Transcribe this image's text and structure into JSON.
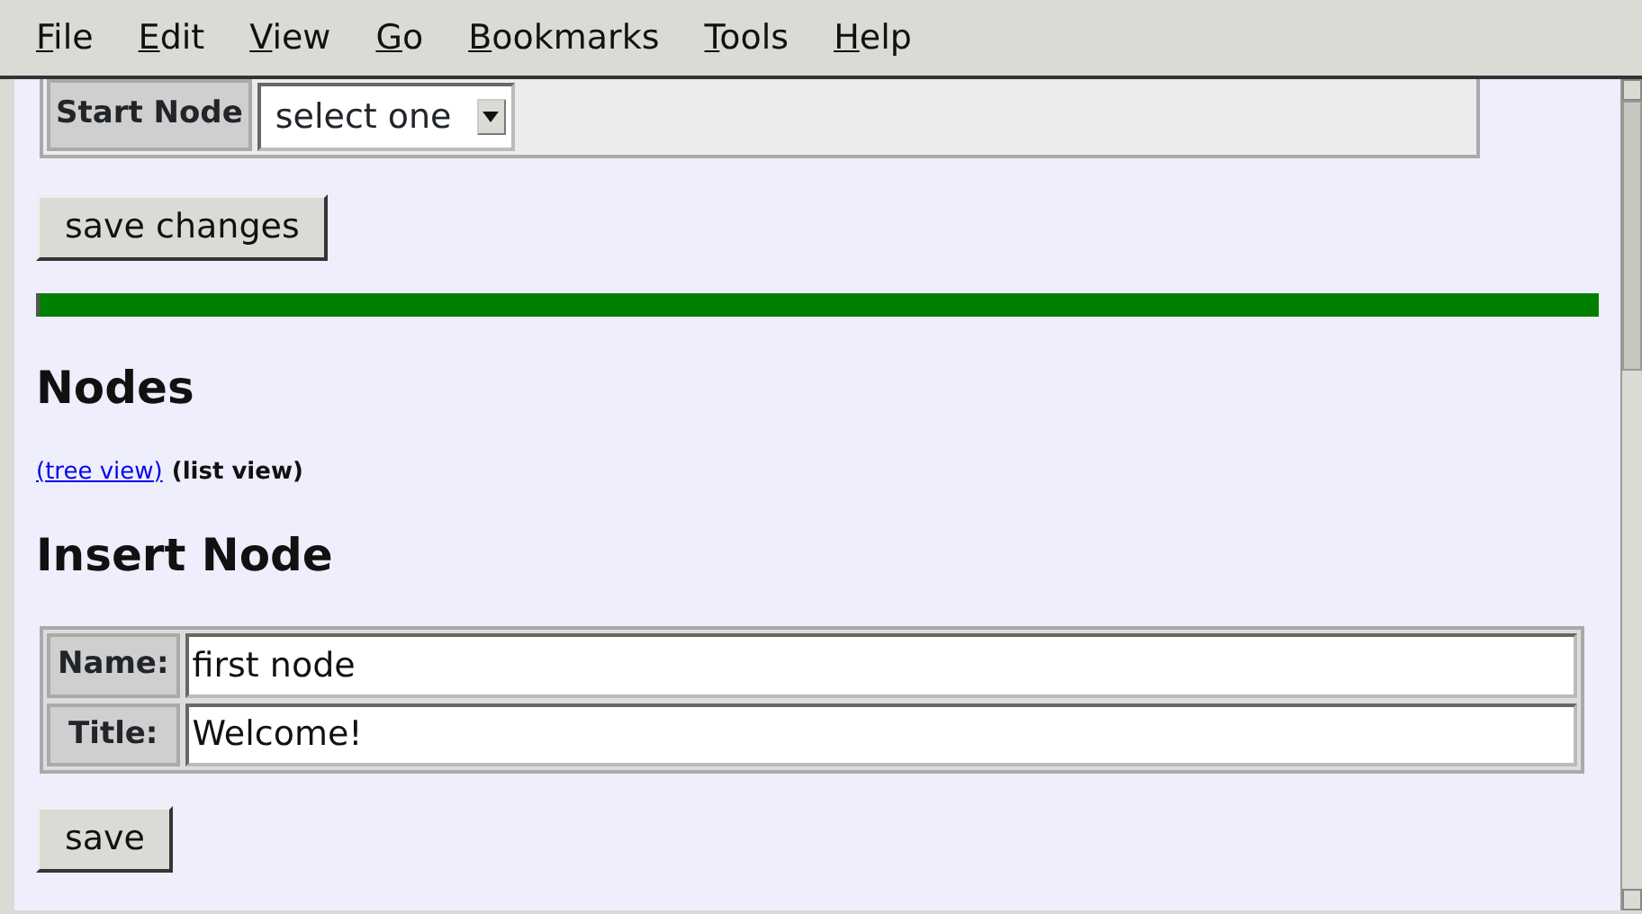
{
  "menu_bar": [
    "File",
    "Edit",
    "View",
    "Go",
    "Bookmarks",
    "Tools",
    "Help"
  ],
  "start_node": {
    "label": "Start Node",
    "value": "select one"
  },
  "save_changes_button": "save changes",
  "nodes_heading": "Nodes",
  "view_links": [
    {
      "label": "(tree view)",
      "selected": false
    },
    {
      "label": "(list view)",
      "selected": true
    }
  ],
  "insert_heading": "Insert Node",
  "fields": [
    {
      "label": "Name:",
      "value": "first node"
    },
    {
      "label": "Title:",
      "value": "Welcome!"
    }
  ],
  "save_button": "save"
}
